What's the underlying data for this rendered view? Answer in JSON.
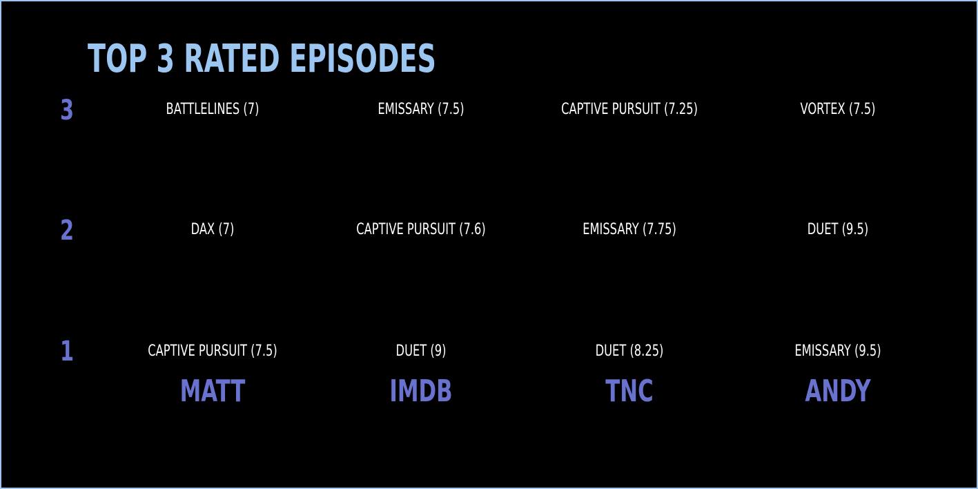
{
  "title": "TOP 3 RATED EPISODES",
  "ranks": [
    "3",
    "2",
    "1"
  ],
  "raters": [
    {
      "name": "MATT",
      "rank3": "BATTLELINES (7)",
      "rank2": "DAX (7)",
      "rank1": "CAPTIVE PURSUIT (7.5)"
    },
    {
      "name": "IMDB",
      "rank3": "EMISSARY (7.5)",
      "rank2": "CAPTIVE PURSUIT (7.6)",
      "rank1": "DUET (9)"
    },
    {
      "name": "TNC",
      "rank3": "CAPTIVE PURSUIT (7.25)",
      "rank2": "EMISSARY (7.75)",
      "rank1": "DUET (8.25)"
    },
    {
      "name": "ANDY",
      "rank3": "VORTEX (7.5)",
      "rank2": "DUET (9.5)",
      "rank1": "EMISSARY (9.5)"
    }
  ],
  "colors": {
    "title": "#9cc6f2",
    "accent": "#6a72d0",
    "text": "#ffffff",
    "background": "#000000",
    "border": "#9cc6f2"
  }
}
